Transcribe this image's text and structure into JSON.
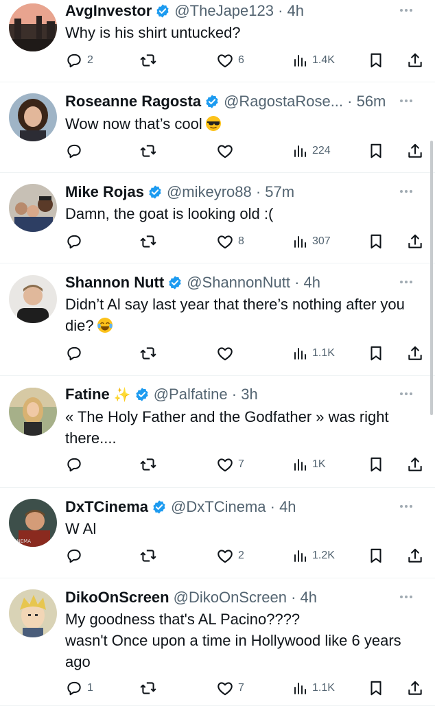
{
  "tweets": [
    {
      "name": "AvgInvestor",
      "verified": true,
      "handle": "@TheJape123 · 4h",
      "text": "Why is his shirt untucked?",
      "emoji": "",
      "replies": "2",
      "retweets": "",
      "likes": "6",
      "views": "1.4K"
    },
    {
      "name": "Roseanne Ragosta",
      "verified": true,
      "handle": "@RagostaRose... · 56m",
      "text": "Wow now that’s cool",
      "emoji": "sunglasses-face",
      "replies": "",
      "retweets": "",
      "likes": "",
      "views": "224"
    },
    {
      "name": "Mike Rojas",
      "verified": true,
      "handle": "@mikeyro88 · 57m",
      "text": "Damn, the goat is looking old :(",
      "emoji": "",
      "replies": "",
      "retweets": "",
      "likes": "8",
      "views": "307"
    },
    {
      "name": "Shannon Nutt",
      "verified": true,
      "handle": "@ShannonNutt · 4h",
      "text": "Didn’t Al say last year that there’s nothing after you die?",
      "emoji": "tears-of-joy-face",
      "replies": "",
      "retweets": "",
      "likes": "",
      "views": "1.1K"
    },
    {
      "name": "Fatine",
      "verified": true,
      "sparkles": "✨",
      "handle": "@Palfatine · 3h",
      "text": "« The Holy Father and the Godfather » was right there....",
      "emoji": "",
      "replies": "",
      "retweets": "",
      "likes": "7",
      "views": "1K"
    },
    {
      "name": "DxTCinema",
      "verified": true,
      "handle": "@DxTCinema · 4h",
      "text": "W Al",
      "emoji": "",
      "replies": "",
      "retweets": "",
      "likes": "2",
      "views": "1.2K"
    },
    {
      "name": "DikoOnScreen",
      "verified": false,
      "handle": "@DikoOnScreen · 4h",
      "text": "My goodness that's AL Pacino????\nwasn't Once upon a time in Hollywood like 6 years ago",
      "emoji": "",
      "replies": "1",
      "retweets": "",
      "likes": "7",
      "views": "1.1K"
    }
  ],
  "colors": {
    "text": "#0f1419",
    "muted": "#536471",
    "verified": "#1d9bf0",
    "divider": "#eff3f4"
  },
  "icons": [
    "reply-icon",
    "retweet-icon",
    "like-icon",
    "views-icon",
    "bookmark-icon",
    "share-icon",
    "more-icon",
    "verified-badge-icon"
  ]
}
